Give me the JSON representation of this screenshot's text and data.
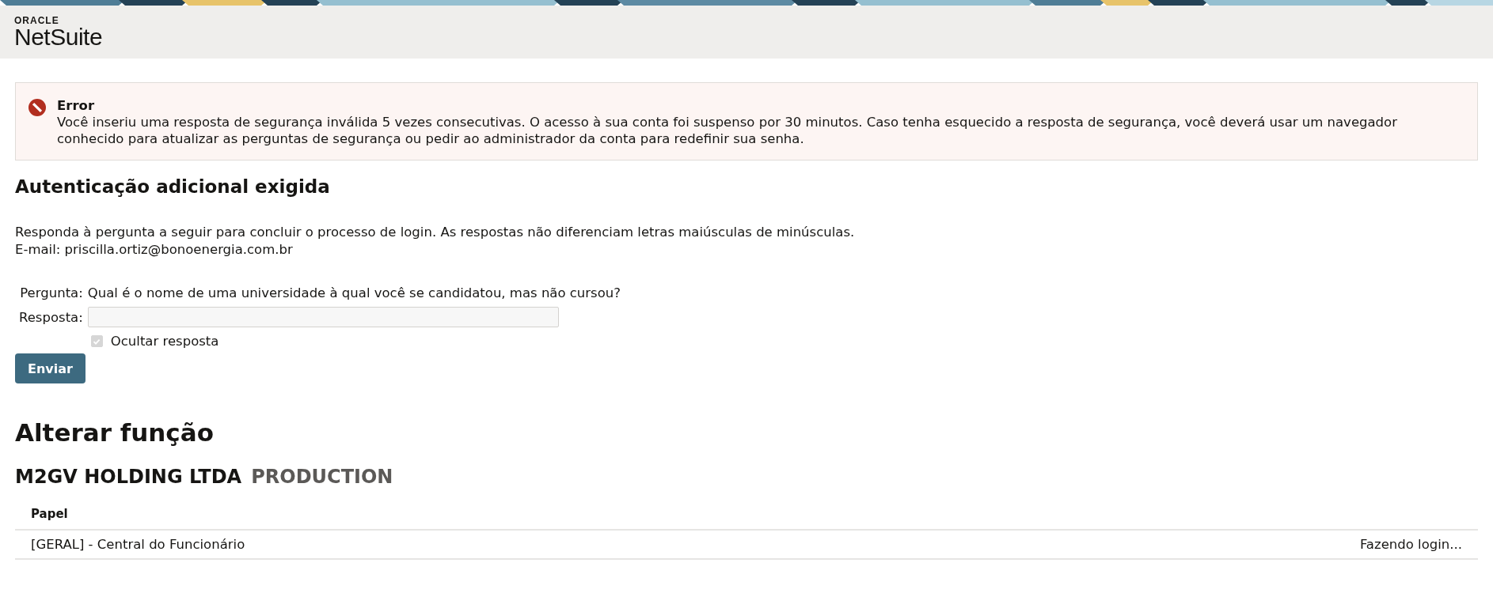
{
  "header": {
    "logo_top": "ORACLE",
    "logo_bottom": "NetSuite"
  },
  "error": {
    "title": "Error",
    "message": "Você inseriu uma resposta de segurança inválida 5 vezes consecutivas. O acesso à sua conta foi suspenso por 30 minutos. Caso tenha esquecido a resposta de segurança, você deverá usar um navegador conhecido para atualizar as perguntas de segurança ou pedir ao administrador da conta para redefinir sua senha."
  },
  "auth": {
    "heading": "Autenticação adicional exigida",
    "instructions": "Responda à pergunta a seguir para concluir o processo de login. As respostas não diferenciam letras maiúsculas de minúsculas.",
    "email": "E-mail: priscilla.ortiz@bonoenergia.com.br",
    "question_label": "Pergunta:",
    "question": "Qual é o nome de uma universidade à qual você se candidatou, mas não cursou?",
    "answer_label": "Resposta:",
    "hide_answer": {
      "label": "Ocultar resposta",
      "checked": true,
      "disabled": true
    },
    "submit": "Enviar"
  },
  "change_role": {
    "heading": "Alterar função",
    "company": "M2GV HOLDING LTDA",
    "environment": "PRODUCTION",
    "table": {
      "columns": [
        "Papel"
      ],
      "rows": [
        {
          "role": "[GERAL] - Central do Funcionário",
          "status": "Fazendo login..."
        }
      ]
    }
  }
}
